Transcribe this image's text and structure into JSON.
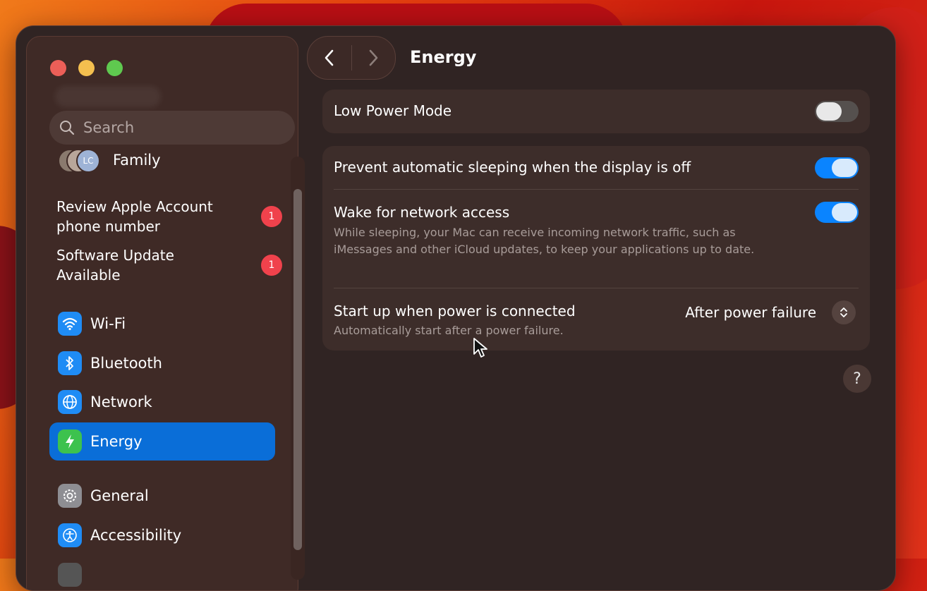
{
  "window": {
    "title": "Energy"
  },
  "sidebar": {
    "search_placeholder": "Search",
    "family": {
      "label": "Family",
      "avatar_initials": "LC"
    },
    "notices": [
      {
        "label": "Review Apple Account phone number",
        "badge": "1"
      },
      {
        "label": "Software Update Available",
        "badge": "1"
      }
    ],
    "items": [
      {
        "label": "Wi-Fi",
        "icon": "wifi-icon"
      },
      {
        "label": "Bluetooth",
        "icon": "bluetooth-icon"
      },
      {
        "label": "Network",
        "icon": "globe-icon"
      },
      {
        "label": "Energy",
        "icon": "bolt-icon",
        "selected": true
      },
      {
        "label": "General",
        "icon": "gear-icon"
      },
      {
        "label": "Accessibility",
        "icon": "accessibility-icon"
      }
    ]
  },
  "settings": {
    "low_power_mode": {
      "label": "Low Power Mode",
      "enabled": false
    },
    "prevent_sleep": {
      "label": "Prevent automatic sleeping when the display is off",
      "enabled": true
    },
    "wake_network": {
      "label": "Wake for network access",
      "description": "While sleeping, your Mac can receive incoming network traffic, such as iMessages and other iCloud updates, to keep your applications up to date.",
      "enabled": true
    },
    "startup_power": {
      "label": "Start up when power is connected",
      "description": "Automatically start after a power failure.",
      "value": "After power failure"
    }
  },
  "help_label": "?",
  "colors": {
    "accent": "#0a84ff",
    "selected_item": "#0a6ed8",
    "badge": "#f0424c"
  }
}
